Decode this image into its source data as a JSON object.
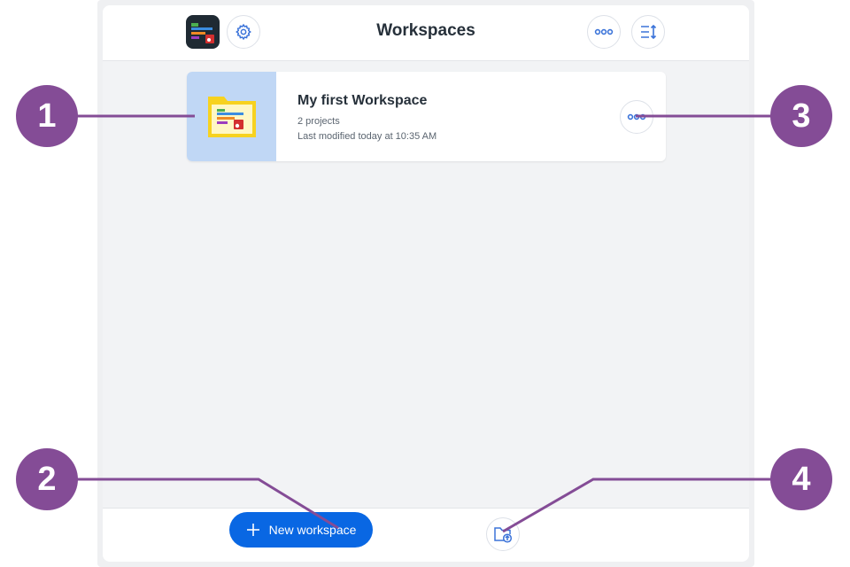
{
  "header": {
    "title": "Workspaces",
    "settings_icon": "gear-icon",
    "more_icon": "ellipsis-icon",
    "sort_icon": "sort-icon"
  },
  "workspaces": [
    {
      "name": "My first Workspace",
      "projects": "2 projects",
      "modified": "Last modified today at 10:35 AM"
    }
  ],
  "footer": {
    "new_workspace_label": "New workspace",
    "plus_icon": "plus-icon",
    "import_icon": "folder-upload-icon"
  },
  "callouts": [
    "1",
    "2",
    "3",
    "4"
  ],
  "colors": {
    "accent": "#0967e3",
    "callout": "#844c96",
    "thumb_bg": "#c0d7f5",
    "icon_blue": "#3b73d9"
  }
}
